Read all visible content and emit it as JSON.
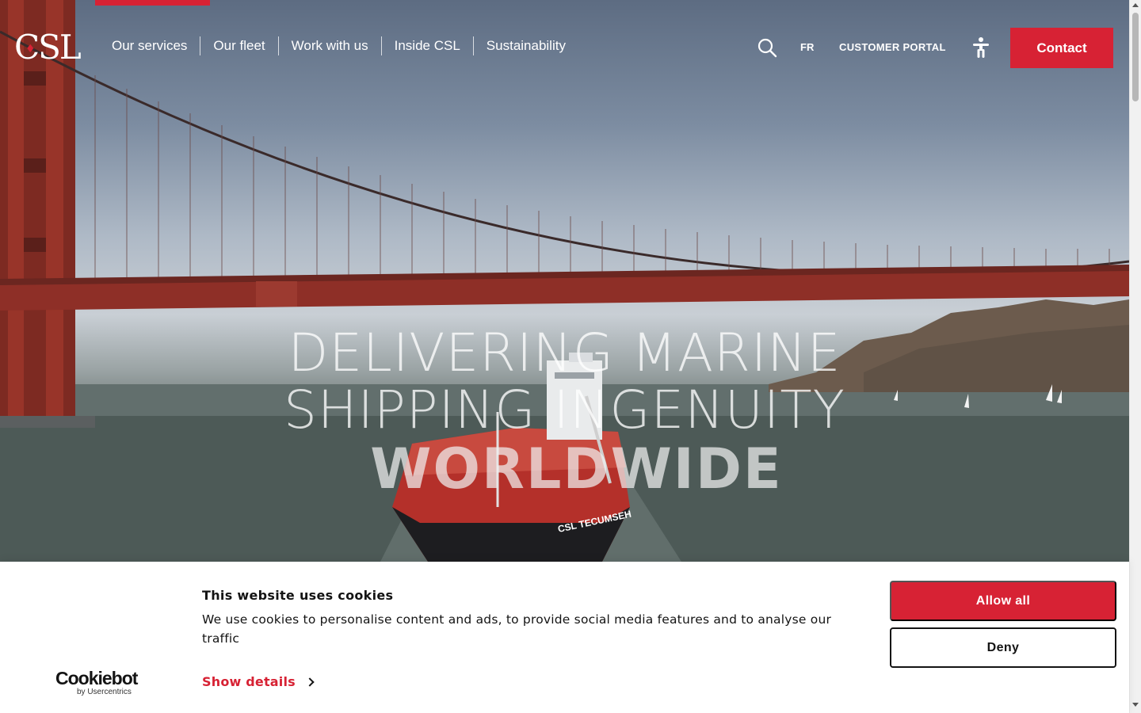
{
  "header": {
    "logo_text": "CSL",
    "nav": [
      "Our services",
      "Our fleet",
      "Work with us",
      "Inside CSL",
      "Sustainability"
    ],
    "search_icon": "search-icon",
    "lang_label": "FR",
    "portal_label": "CUSTOMER PORTAL",
    "accessibility_icon": "accessibility-icon",
    "contact_label": "Contact"
  },
  "hero": {
    "line1": "DELIVERING MARINE",
    "line2": "SHIPPING INGENUITY",
    "line3": "WORLDWIDE",
    "ship_name": "CSL TECUMSEH"
  },
  "cookie_banner": {
    "title": "This website uses cookies",
    "text": "We use cookies to personalise content and ads, to provide social media features and to analyse our traffic",
    "show_details_label": "Show details",
    "allow_label": "Allow all",
    "deny_label": "Deny",
    "provider_name": "Cookiebot",
    "provider_sub": "by Usercentrics"
  },
  "colors": {
    "brand_red": "#d72234",
    "text_dark": "#141414"
  }
}
